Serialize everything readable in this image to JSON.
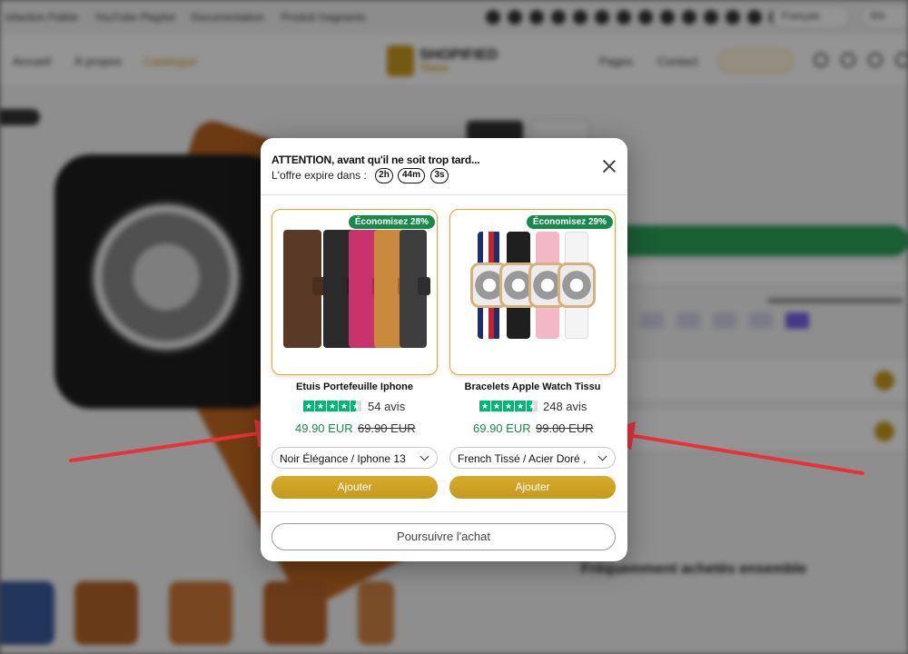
{
  "background": {
    "topbar": {
      "links": [
        "isfaction Fidèle",
        "YouTube Playlist",
        "Documentation",
        "Produit Gagnants"
      ],
      "lang_1": "Français",
      "lang_2": "EN"
    },
    "nav": {
      "left": [
        "Accueil",
        "À propos",
        "Catalogue"
      ],
      "right": [
        "Pages",
        "Contact"
      ],
      "contact_btn": "Sans Barrière",
      "logo_word": "SHOPIFIED",
      "logo_sub": "Theme"
    },
    "section_title": "Fréquemment achetés ensemble"
  },
  "modal": {
    "title": "ATTENTION, avant qu'il ne soit trop tard...",
    "subtitle": "L'offre expire dans :",
    "timer": [
      "2h",
      "44m",
      "3s"
    ],
    "continue_label": "Poursuivre l'achat",
    "products": [
      {
        "badge": "Économisez 28%",
        "name": "Etuis Portefeuille Iphone",
        "rating": 4.5,
        "reviews": "54 avis",
        "price": "49.90 EUR",
        "old_price": "69.90 EUR",
        "variant": "Noir Élégance / Iphone 13",
        "add_label": "Ajouter"
      },
      {
        "badge": "Économisez 29%",
        "name": "Bracelets Apple Watch Tissu",
        "rating": 4.5,
        "reviews": "248 avis",
        "price": "69.90 EUR",
        "old_price": "99.00 EUR",
        "variant": "French Tissé / Acier Doré ,",
        "add_label": "Ajouter"
      }
    ]
  },
  "colors": {
    "accent_gold": "#c9a020",
    "green": "#178a4b",
    "trustpilot": "#00b67a",
    "arrow_red": "#e8323a"
  }
}
